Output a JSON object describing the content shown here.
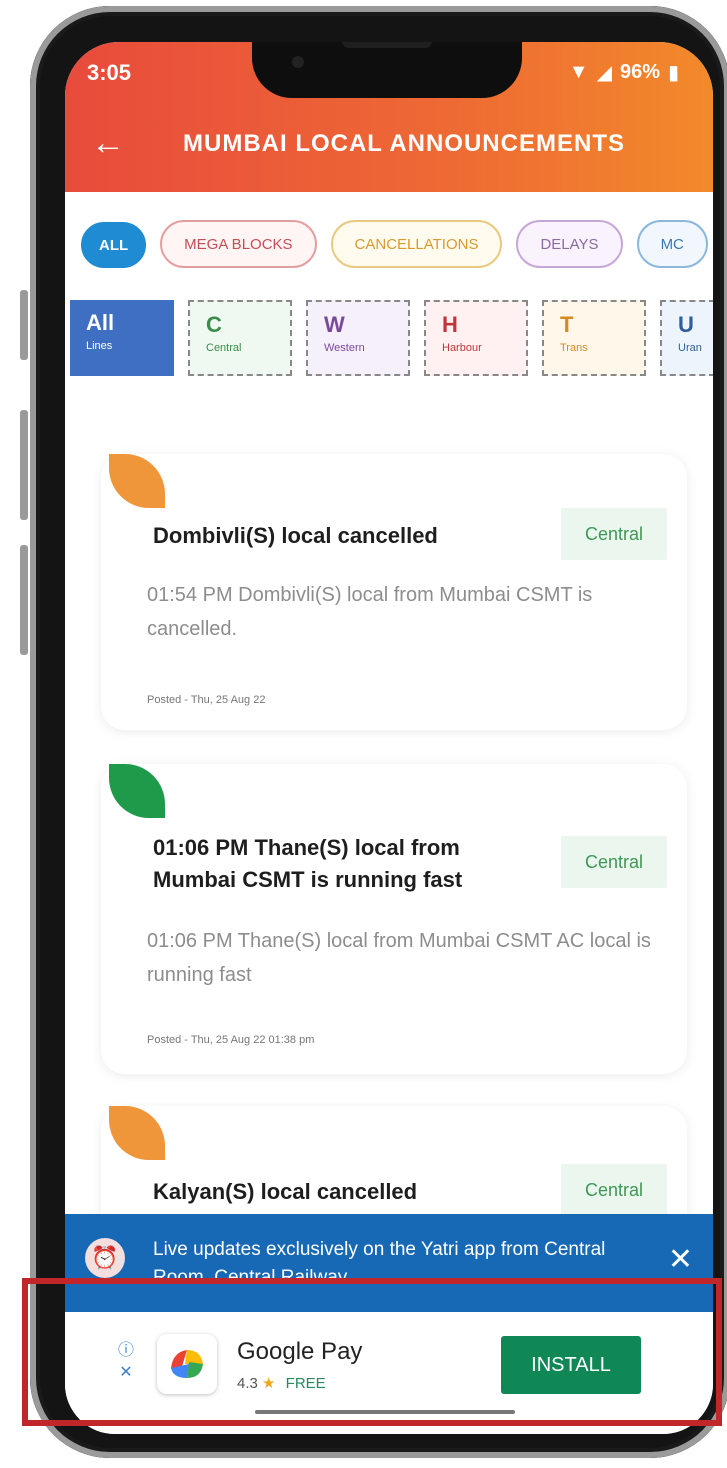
{
  "status_bar": {
    "time": "3:05",
    "battery": "96%"
  },
  "header": {
    "title": "MUMBAI LOCAL ANNOUNCEMENTS"
  },
  "chips": [
    "ALL",
    "MEGA BLOCKS",
    "CANCELLATIONS",
    "DELAYS",
    "MC"
  ],
  "lines": [
    {
      "code": "All",
      "label": "Lines"
    },
    {
      "code": "C",
      "label": "Central"
    },
    {
      "code": "W",
      "label": "Western"
    },
    {
      "code": "H",
      "label": "Harbour"
    },
    {
      "code": "T",
      "label": "Trans"
    },
    {
      "code": "U",
      "label": "Uran"
    }
  ],
  "cards": [
    {
      "title": "Dombivli(S) local cancelled",
      "badge": "Central",
      "body": "01:54 PM Dombivli(S) local from Mumbai CSMT is cancelled.",
      "posted": "Posted - Thu, 25 Aug 22",
      "leaf_color": "#ef963a"
    },
    {
      "title": "01:06 PM Thane(S) local from Mumbai CSMT is running fast",
      "badge": "Central",
      "body": "01:06 PM Thane(S) local from Mumbai CSMT AC local is running fast",
      "posted": "Posted - Thu, 25 Aug 22 01:38 pm",
      "leaf_color": "#1f9a4a"
    },
    {
      "title": "Kalyan(S) local cancelled",
      "badge": "Central",
      "leaf_color": "#ef963a"
    }
  ],
  "banner": {
    "text": "Live updates exclusively on the Yatri app from Central Room, Central Railway",
    "close": "✕"
  },
  "ad": {
    "app_name": "Google Pay",
    "rating": "4.3",
    "star": "★",
    "price": "FREE",
    "install_label": "INSTALL",
    "info_icon": "ⓘ",
    "close_icon": "✕"
  },
  "colors": {
    "header_start": "#e84b3c",
    "header_end": "#f28a2a",
    "banner": "#1769b5",
    "install": "#0f8856",
    "highlight": "#c0262a"
  }
}
